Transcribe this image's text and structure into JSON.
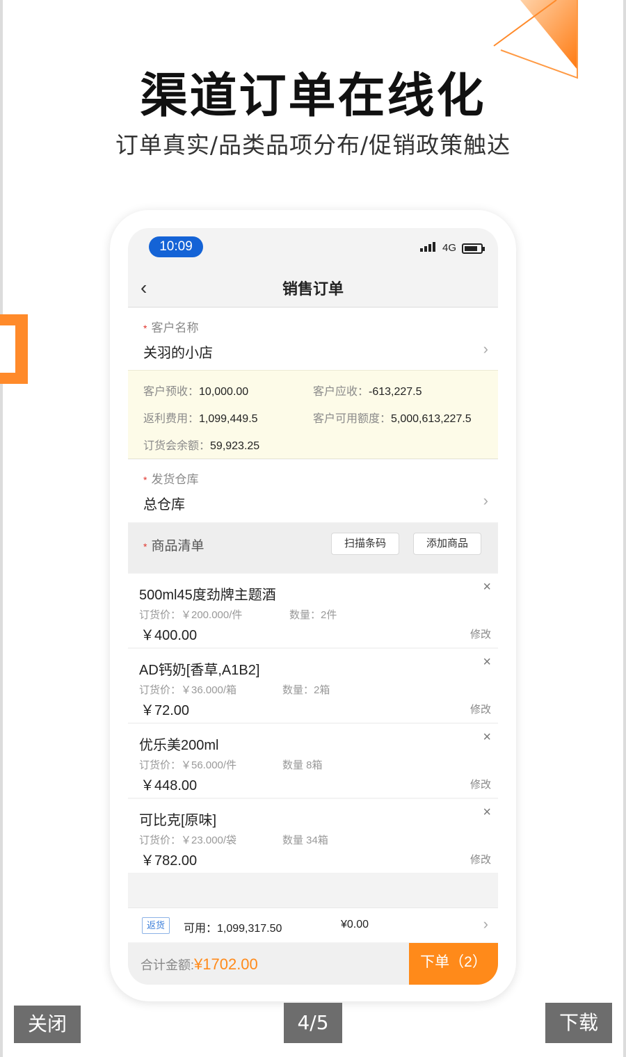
{
  "hero": {
    "title": "渠道订单在线化",
    "subtitle": "订单真实/品类品项分布/促销政策触达"
  },
  "status_bar": {
    "time": "10:09",
    "network": "4G"
  },
  "nav": {
    "title": "销售订单",
    "back_icon": "chevron-left-icon"
  },
  "customer": {
    "label": "客户名称",
    "value": "关羽的小店"
  },
  "info": {
    "prepaid_label": "客户预收：",
    "prepaid_value": "10,000.00",
    "receivable_label": "客户应收：",
    "receivable_value": "-613,227.5",
    "rebate_label": "返利费用：",
    "rebate_value": "1,099,449.5",
    "credit_label": "客户可用额度：",
    "credit_value": "5,000,613,227.5",
    "balance_label": "订货会余额：",
    "balance_value": "59,923.25"
  },
  "warehouse": {
    "label": "发货仓库",
    "value": "总仓库"
  },
  "goods": {
    "label": "商品清单",
    "scan_button": "扫描条码",
    "add_button": "添加商品",
    "items": [
      {
        "name": "500ml45度劲牌主题酒",
        "price": "订货价：￥200.000/件",
        "qty": "数量：2件",
        "total": "￥400.00",
        "edit": "修改"
      },
      {
        "name": "AD钙奶[香草,A1B2]",
        "price": "订货价：￥36.000/箱",
        "qty": "数量：2箱",
        "total": "￥72.00",
        "edit": "修改"
      },
      {
        "name": "优乐美200ml",
        "price": "订货价：￥56.000/件",
        "qty": "数量  8箱",
        "total": "￥448.00",
        "edit": "修改"
      },
      {
        "name": "可比克[原味]",
        "price": "订货价：￥23.000/袋",
        "qty": "数量  34箱",
        "total": "￥782.00",
        "edit": "修改"
      }
    ]
  },
  "return_row": {
    "badge": "返货",
    "available": "可用：1,099,317.50",
    "amount": "¥0.00"
  },
  "footer": {
    "total_label": "合计金额:",
    "total_value": "¥1702.00",
    "submit": "下单（2）"
  },
  "viewer": {
    "close": "关闭",
    "page": "4/5",
    "download": "下载"
  },
  "colors": {
    "accent": "#ff8a1a",
    "time_pill": "#1463d6",
    "required": "#e0342c",
    "info_bg": "#fdfbe8"
  }
}
